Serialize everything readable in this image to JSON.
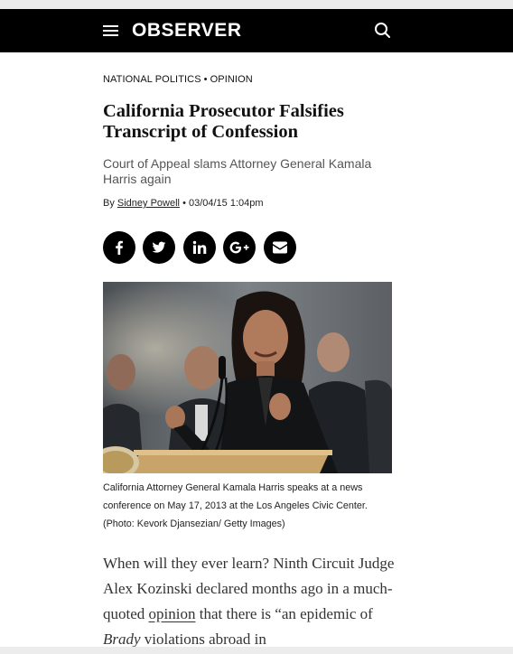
{
  "header": {
    "logo": "OBSERVER",
    "menu_icon": "hamburger-menu-icon",
    "search_icon": "search-icon",
    "background": "#000000"
  },
  "article": {
    "category_1": "NATIONAL POLITICS",
    "category_sep": "•",
    "category_2": "OPINION",
    "title": "California Prosecutor Falsifies Transcript of Confession",
    "subtitle": "Court of Appeal slams Attorney General Kamala Harris again",
    "byline_prefix": "By",
    "author": "Sidney Powell",
    "date": "• 03/04/15 1:04pm"
  },
  "share": [
    {
      "icon": "facebook-icon"
    },
    {
      "icon": "twitter-icon"
    },
    {
      "icon": "linkedin-icon"
    },
    {
      "icon": "google-plus-icon"
    },
    {
      "icon": "email-icon"
    }
  ],
  "photo": {
    "caption_line1": "California Attorney General Kamala Harris speaks at a news",
    "caption_line2": "conference on May 17, 2013 at the Los Angeles Civic Center.",
    "caption_line3": "(Photo: Kevork Djansezian/ Getty Images)"
  },
  "body": {
    "text_1": "When will they ever learn? Ninth Circuit Judge Alex Kozinski declared months ago in a much-quoted ",
    "link": "opinion",
    "text_2": " that there is “an epidemic of ",
    "italic": "Brady",
    "text_3": " violations abroad in"
  }
}
